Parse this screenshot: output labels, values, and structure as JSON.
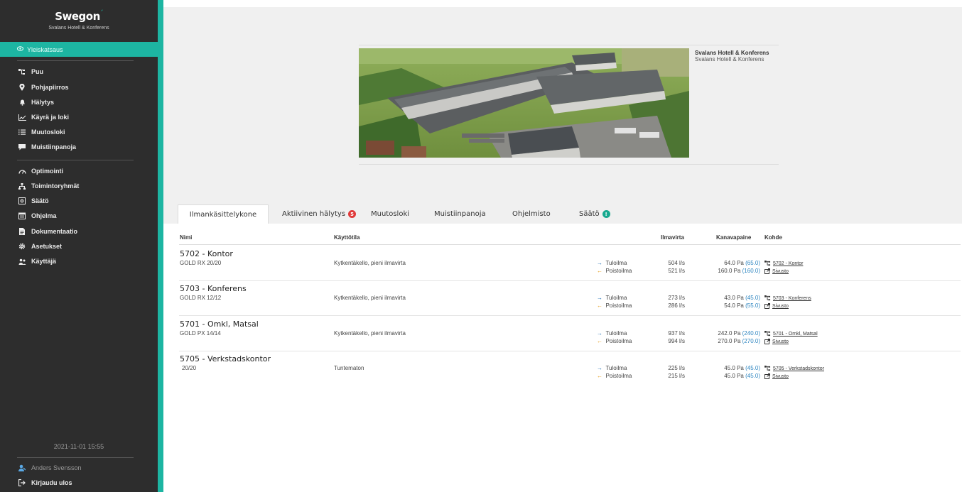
{
  "sidebar": {
    "brand": "Swegon",
    "site_name": "Svalans Hotell & Konferens",
    "active_item": "Yleiskatsaus",
    "group1": [
      "Puu",
      "Pohjapiirros",
      "Hälytys",
      "Käyrä ja loki",
      "Muutosloki",
      "Muistiinpanoja"
    ],
    "group2": [
      "Optimointi",
      "Toimintoryhmät",
      "Säätö",
      "Ohjelma",
      "Dokumentaatio",
      "Asetukset",
      "Käyttäjä"
    ],
    "datetime": "2021-11-01 15:55",
    "user": "Anders Svensson",
    "logout": "Kirjaudu ulos"
  },
  "site": {
    "title": "Svalans Hotell & Konferens",
    "subtitle": "Svalans Hotell & Konferens"
  },
  "tabs": [
    {
      "label": "Ilmankäsittelykone"
    },
    {
      "label": "Aktiivinen hälytys",
      "badge": "5"
    },
    {
      "label": "Muutosloki"
    },
    {
      "label": "Muistiinpanoja"
    },
    {
      "label": "Ohjelmisto"
    },
    {
      "label": "Säätö",
      "badge": "!"
    }
  ],
  "table": {
    "headers": {
      "name": "Nimi",
      "operation": "Käyttötila",
      "airflow": "Ilmavirta",
      "pressure": "Kanavapaine",
      "target": "Kohde"
    },
    "rows": [
      {
        "name": "5702 - Kontor",
        "model": "GOLD RX 20/20",
        "mode": "Kytkentäkello, pieni ilmavirta",
        "supply_label": "Tuloilma",
        "exhaust_label": "Poistoilma",
        "supply_flow": "504 l/s",
        "exhaust_flow": "521 l/s",
        "supply_pressure": "64.0 Pa",
        "supply_setpoint": "(65.0)",
        "exhaust_pressure": "160.0 Pa",
        "exhaust_setpoint": "(160.0)",
        "target_link": "5702 - Kontor",
        "site_link": "Sivusto"
      },
      {
        "name": "5703 - Konferens",
        "model": "GOLD RX 12/12",
        "mode": "Kytkentäkello, pieni ilmavirta",
        "supply_label": "Tuloilma",
        "exhaust_label": "Poistoilma",
        "supply_flow": "273 l/s",
        "exhaust_flow": "286 l/s",
        "supply_pressure": "43.0 Pa",
        "supply_setpoint": "(45.0)",
        "exhaust_pressure": "54.0 Pa",
        "exhaust_setpoint": "(55.0)",
        "target_link": "5703 - Konferens",
        "site_link": "Sivusto"
      },
      {
        "name": "5701 - Omkl, Matsal",
        "model": "GOLD PX 14/14",
        "mode": "Kytkentäkello, pieni ilmavirta",
        "supply_label": "Tuloilma",
        "exhaust_label": "Poistoilma",
        "supply_flow": "937 l/s",
        "exhaust_flow": "994 l/s",
        "supply_pressure": "242.0 Pa",
        "supply_setpoint": "(240.0)",
        "exhaust_pressure": "270.0 Pa",
        "exhaust_setpoint": "(270.0)",
        "target_link": "5701 - Omkl, Matsal",
        "site_link": "Sivusto"
      },
      {
        "name": "5705 - Verkstadskontor",
        "model": "20/20",
        "mode": "Tuntematon",
        "supply_label": "Tuloilma",
        "exhaust_label": "Poistoilma",
        "supply_flow": "225 l/s",
        "exhaust_flow": "215 l/s",
        "supply_pressure": "45.0 Pa",
        "supply_setpoint": "(45.0)",
        "exhaust_pressure": "45.0 Pa",
        "exhaust_setpoint": "(45.0)",
        "target_link": "5705 - Verkstadskontor",
        "site_link": "Sivusto"
      }
    ]
  },
  "colors": {
    "accent": "#1db5a2",
    "sidebar": "#2d2d2d",
    "supply_arrow": "#1f6fb5",
    "exhaust_arrow": "#e6a020",
    "alarm_badge": "#e03a3a"
  }
}
